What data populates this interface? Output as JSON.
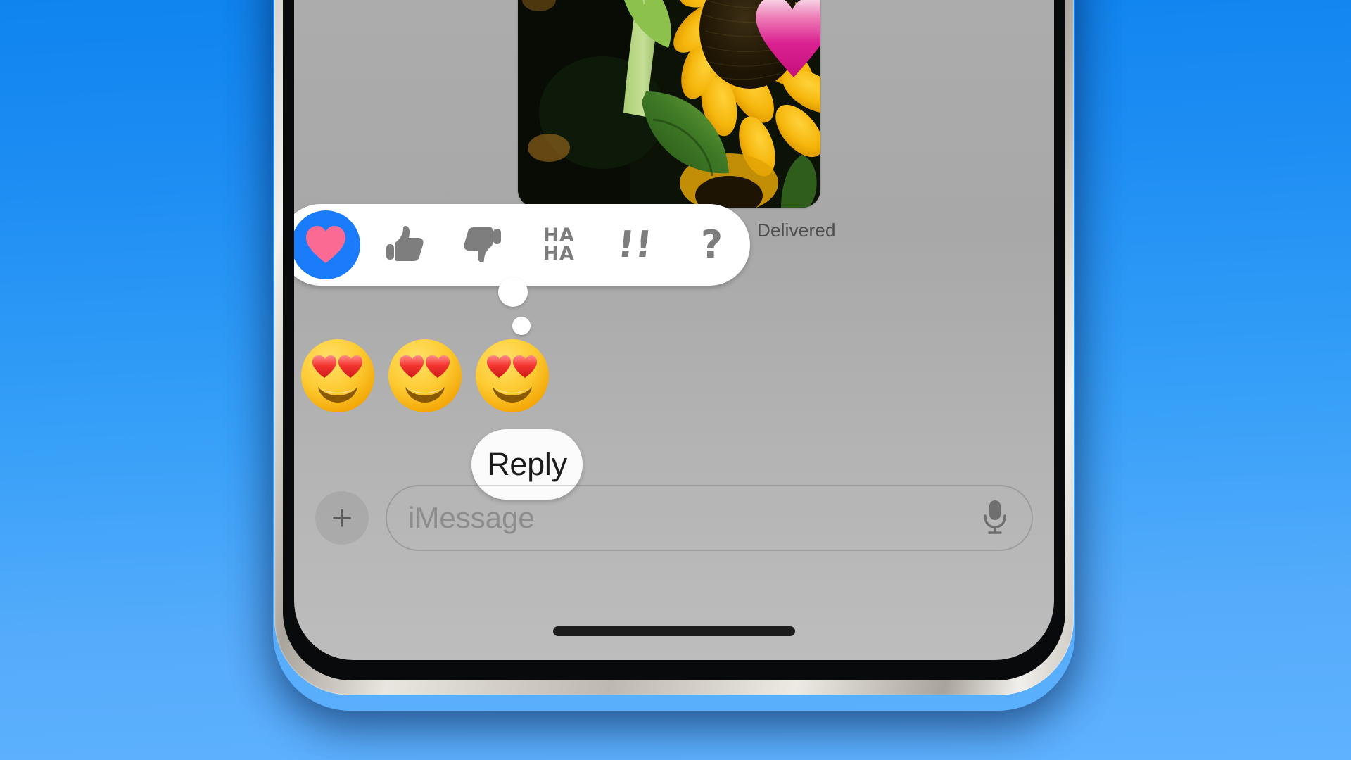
{
  "background": {
    "gradient_top": "#0f84ef",
    "gradient_bottom": "#5eb2ff"
  },
  "device": {
    "name": "iphone-frame",
    "frame_color": "#c9c5bd",
    "bezel_color": "#090a0c",
    "screen_background": "#adadad"
  },
  "app": {
    "name": "Messages",
    "screen": "conversation"
  },
  "message": {
    "type": "photo",
    "alt": "Sunflowers with green leaves",
    "sticker": "two-pink-hearts",
    "status": "Delivered"
  },
  "tapback": {
    "name": "tapback-reaction-bar",
    "selected": "heart",
    "selected_bg": "#1a7cfa",
    "heart_color": "#fb6a92",
    "glyph_color": "#7d7d7d",
    "bar_background": "#ffffff",
    "options": [
      {
        "id": "heart",
        "label": "Heart",
        "glyph": "♥",
        "selected": true
      },
      {
        "id": "thumbsup",
        "label": "Thumbs Up",
        "glyph": "",
        "selected": false
      },
      {
        "id": "thumbsdown",
        "label": "Thumbs Down",
        "glyph": "",
        "selected": false
      },
      {
        "id": "haha",
        "label": "Haha",
        "line1": "HA",
        "line2": "HA",
        "selected": false
      },
      {
        "id": "emphasize",
        "label": "Emphasize",
        "glyph": "!!",
        "selected": false
      },
      {
        "id": "question",
        "label": "Question",
        "glyph": "?",
        "selected": false
      }
    ]
  },
  "reactions": {
    "name": "sent-reactions",
    "emoji_label": "smiling-face-with-heart-eyes",
    "items": [
      {
        "emoji": "heart-eyes"
      },
      {
        "emoji": "heart-eyes"
      },
      {
        "emoji": "heart-eyes"
      }
    ]
  },
  "reply": {
    "label": "Reply",
    "background": "#fbfbfb",
    "text_color": "#1c1c1c"
  },
  "composer": {
    "add_label": "+",
    "placeholder": "iMessage",
    "mic_label": "Dictate",
    "placeholder_color": "#8c8c8c"
  },
  "home_indicator": {
    "color": "#1c1c1c"
  }
}
